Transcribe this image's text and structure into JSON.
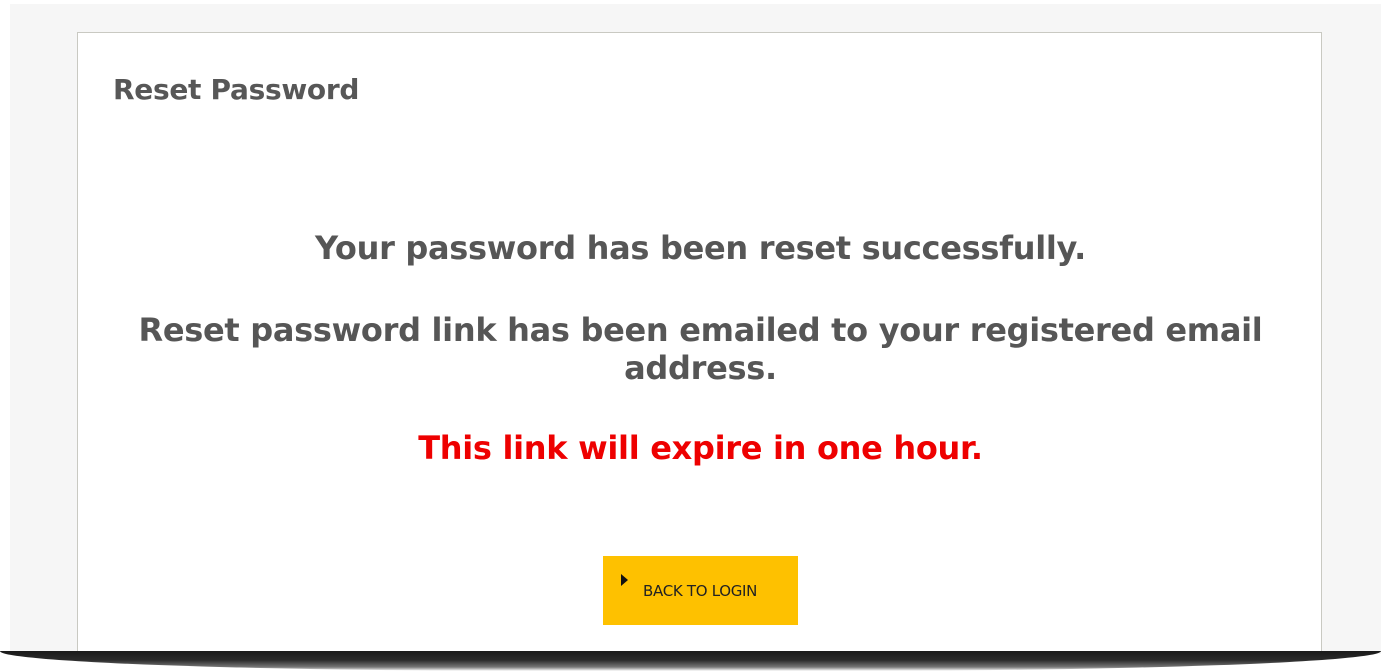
{
  "card": {
    "title": "Reset Password"
  },
  "messages": {
    "success": "Your password has been reset successfully.",
    "emailed": "Reset password link has been emailed to your registered email address.",
    "expire": "This link will expire in one hour."
  },
  "actions": {
    "back_to_login_label": "BACK TO LOGIN"
  },
  "colors": {
    "page_background": "#f6f6f6",
    "card_border": "#c9c9c2",
    "text": "#565656",
    "warning": "#ee0000",
    "button": "#fec100"
  }
}
